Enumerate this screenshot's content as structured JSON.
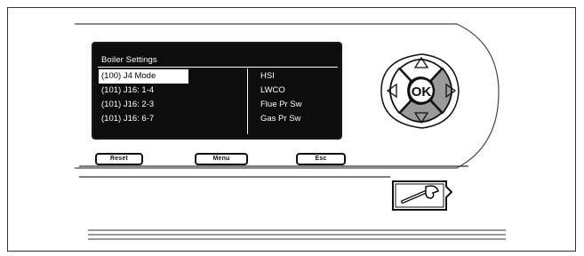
{
  "screen": {
    "title": "Boiler Settings",
    "left_items": [
      {
        "label": "(100) J4 Mode",
        "selected": true
      },
      {
        "label": "(101) J16: 1-4",
        "selected": false
      },
      {
        "label": "(101) J16: 2-3",
        "selected": false
      },
      {
        "label": "(101) J16: 6-7",
        "selected": false
      }
    ],
    "right_items": [
      "HSI",
      "LWCO",
      "Flue Pr Sw",
      "Gas Pr Sw"
    ]
  },
  "softkeys": {
    "reset": "Reset",
    "menu": "Menu",
    "esc": "Esc"
  },
  "nav_pad": {
    "ok": "OK",
    "up_icon": "triangle-up-icon",
    "down_icon": "triangle-down-icon",
    "left_icon": "triangle-left-icon",
    "right_icon": "triangle-right-icon"
  },
  "service_button": {
    "icon": "wrench-icon"
  },
  "colors": {
    "lcd_background": "#0d0d0d",
    "lcd_text": "#ffffff",
    "key_highlight": "#9a9a9a"
  }
}
